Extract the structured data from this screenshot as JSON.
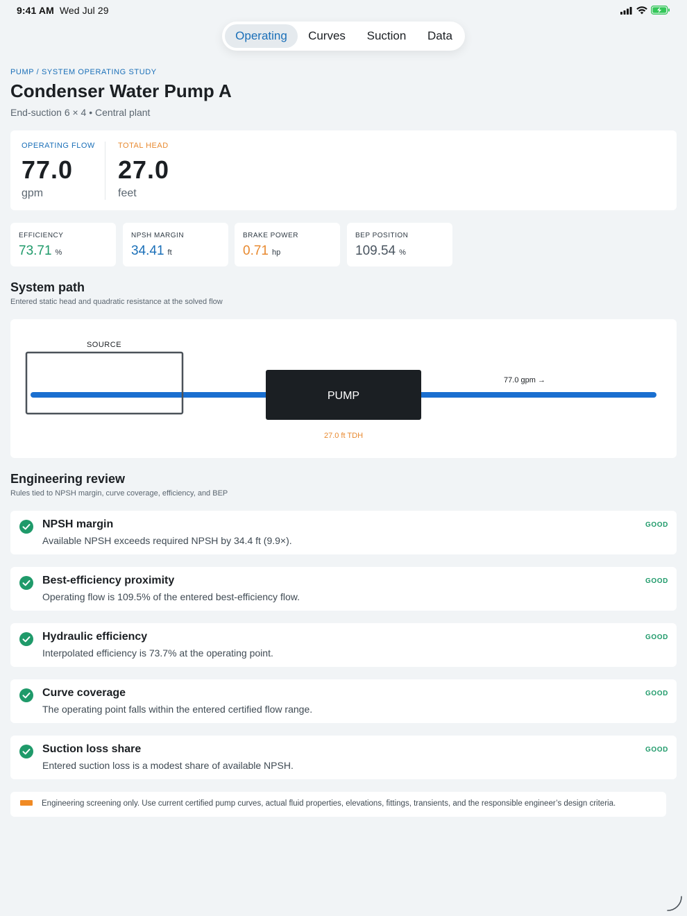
{
  "status_bar": {
    "time": "9:41 AM",
    "date": "Wed Jul 29"
  },
  "tabs": [
    {
      "label": "Operating",
      "active": true
    },
    {
      "label": "Curves",
      "active": false
    },
    {
      "label": "Suction",
      "active": false
    },
    {
      "label": "Data",
      "active": false
    }
  ],
  "header": {
    "breadcrumb": "PUMP / SYSTEM OPERATING STUDY",
    "title": "Condenser Water Pump A",
    "subtitle": "End-suction 6 × 4 • Central plant"
  },
  "hero": {
    "flow": {
      "label": "OPERATING FLOW",
      "value": "77.0",
      "unit": "gpm"
    },
    "head": {
      "label": "TOTAL HEAD",
      "value": "27.0",
      "unit": "feet"
    }
  },
  "metrics": [
    {
      "label": "EFFICIENCY",
      "value": "73.71",
      "unit": "%",
      "color": "#1f9a6a"
    },
    {
      "label": "NPSH MARGIN",
      "value": "34.41",
      "unit": "ft",
      "color": "#1a6fb8"
    },
    {
      "label": "BRAKE POWER",
      "value": "0.71",
      "unit": "hp",
      "color": "#e8892f"
    },
    {
      "label": "BEP POSITION",
      "value": "109.54",
      "unit": "%",
      "color": "#4a5560"
    }
  ],
  "system_path": {
    "title": "System path",
    "subtitle": "Entered static head and quadratic resistance at the solved flow",
    "source_label": "SOURCE",
    "pump_label": "PUMP",
    "flow_label": "77.0 gpm →",
    "tdh_label": "27.0 ft TDH"
  },
  "review": {
    "title": "Engineering review",
    "subtitle": "Rules tied to NPSH margin, curve coverage, efficiency, and BEP",
    "items": [
      {
        "title": "NPSH margin",
        "desc": "Available NPSH exceeds required NPSH by 34.4 ft (9.9×).",
        "status": "GOOD"
      },
      {
        "title": "Best-efficiency proximity",
        "desc": "Operating flow is 109.5% of the entered best-efficiency flow.",
        "status": "GOOD"
      },
      {
        "title": "Hydraulic efficiency",
        "desc": "Interpolated efficiency is 73.7% at the operating point.",
        "status": "GOOD"
      },
      {
        "title": "Curve coverage",
        "desc": "The operating point falls within the entered certified flow range.",
        "status": "GOOD"
      },
      {
        "title": "Suction loss share",
        "desc": "Entered suction loss is a modest share of available NPSH.",
        "status": "GOOD"
      }
    ]
  },
  "disclaimer": "Engineering screening only. Use current certified pump curves, actual fluid properties, elevations, fittings, transients, and the responsible engineer’s design criteria.",
  "colors": {
    "accent": "#1a6fb8",
    "good": "#1f9a6a",
    "warning": "#e8892f",
    "pump": "#1b1f23"
  }
}
